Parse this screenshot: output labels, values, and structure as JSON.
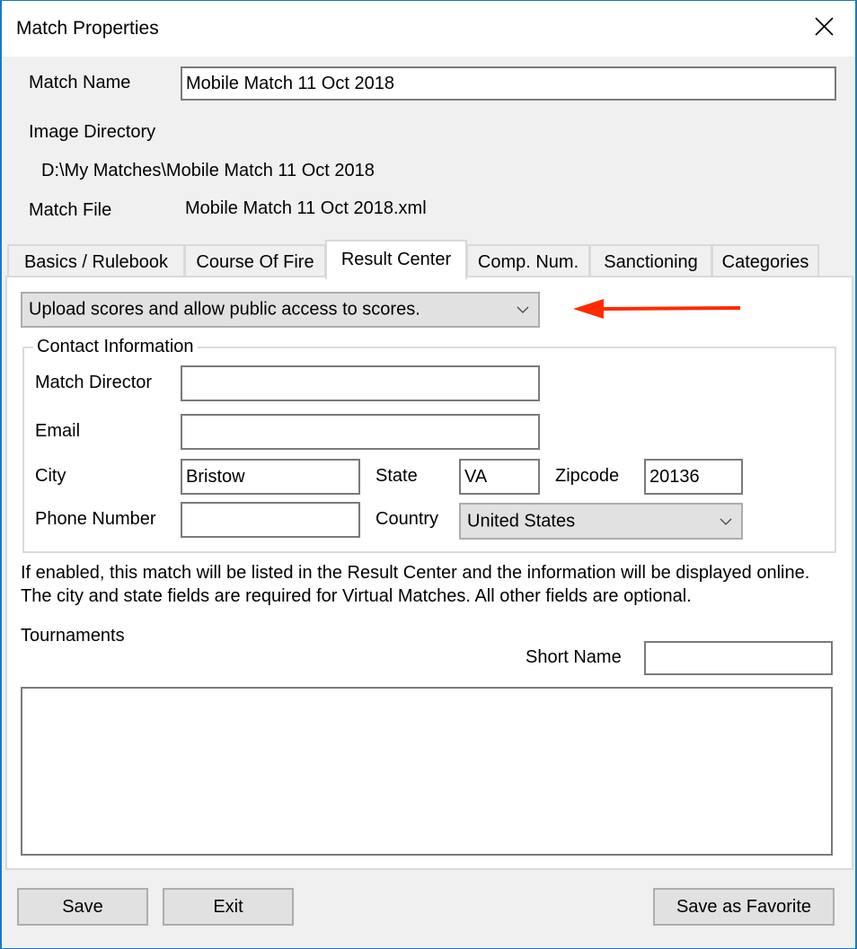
{
  "window": {
    "title": "Match Properties",
    "close_icon": "close-icon"
  },
  "header": {
    "match_name_label": "Match Name",
    "match_name_value": "Mobile Match 11 Oct 2018",
    "image_directory_label": "Image Directory",
    "image_directory_value": "D:\\My Matches\\Mobile Match 11 Oct 2018",
    "match_file_label": "Match File",
    "match_file_value": "Mobile Match 11 Oct 2018.xml"
  },
  "tabs": [
    {
      "label": "Basics / Rulebook",
      "active": false
    },
    {
      "label": "Course Of Fire",
      "active": false
    },
    {
      "label": "Result Center",
      "active": true
    },
    {
      "label": "Comp. Num.",
      "active": false
    },
    {
      "label": "Sanctioning",
      "active": false
    },
    {
      "label": "Categories",
      "active": false
    }
  ],
  "result_center": {
    "upload_option": "Upload scores and allow public access to scores.",
    "annotation_arrow_color": "#ff2a00",
    "contact": {
      "legend": "Contact Information",
      "match_director_label": "Match Director",
      "match_director_value": "",
      "email_label": "Email",
      "email_value": "",
      "city_label": "City",
      "city_value": "Bristow",
      "state_label": "State",
      "state_value": "VA",
      "zipcode_label": "Zipcode",
      "zipcode_value": "20136",
      "phone_label": "Phone Number",
      "phone_value": "",
      "country_label": "Country",
      "country_value": "United States"
    },
    "info_line1": "If enabled, this match will be listed in the Result Center and the information will be displayed online.",
    "info_line2": "The city and state fields are required for Virtual Matches. All other fields are optional.",
    "tournaments_label": "Tournaments",
    "short_name_label": "Short Name",
    "short_name_value": "",
    "tournaments_list": []
  },
  "footer": {
    "save": "Save",
    "exit": "Exit",
    "save_favorite": "Save as Favorite"
  }
}
